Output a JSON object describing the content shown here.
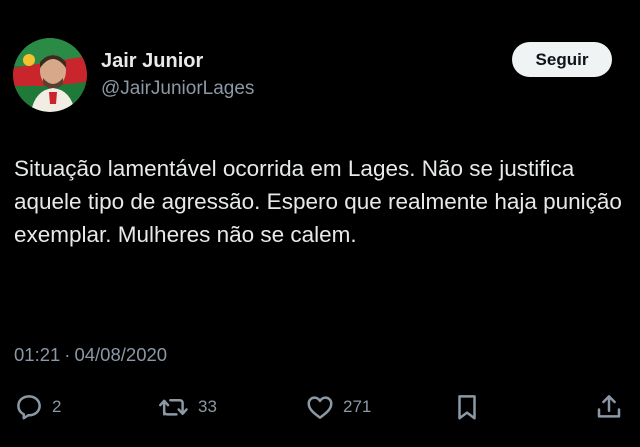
{
  "user": {
    "display_name": "Jair Junior",
    "handle": "@JairJuniorLages",
    "avatar_icon": "profile-photo"
  },
  "follow_button": {
    "label": "Seguir"
  },
  "tweet": {
    "text": "Situação lamentável ocorrida em Lages. Não se justifica aquele tipo de agressão. Espero que realmente haja punição exemplar. Mulheres não se calem.",
    "time": "01:21",
    "separator": "·",
    "date": "04/08/2020"
  },
  "actions": {
    "reply_count": "2",
    "retweet_count": "33",
    "like_count": "271"
  },
  "colors": {
    "background": "#000000",
    "text_primary": "#e7e9ea",
    "text_secondary": "#8b98a5",
    "button_bg": "#eff3f4",
    "button_text": "#0f1419"
  }
}
